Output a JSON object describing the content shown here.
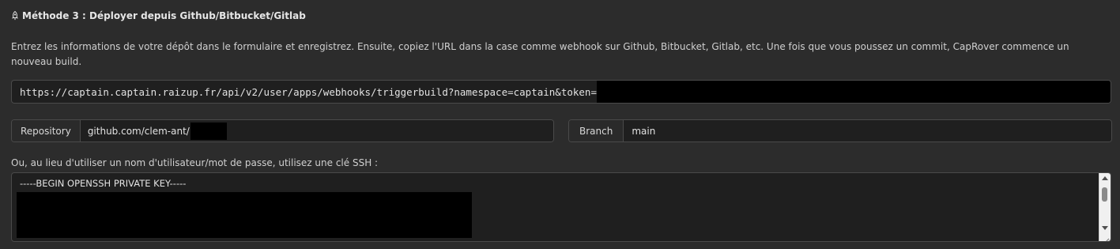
{
  "section": {
    "icon": "rocket-icon",
    "title": "Méthode 3 : Déployer depuis Github/Bitbucket/Gitlab"
  },
  "description": "Entrez les informations de votre dépôt dans le formulaire et enregistrez. Ensuite, copiez l'URL dans la case comme webhook sur Github, Bitbucket, Gitlab, etc. Une fois que vous poussez un commit, CapRover commence un nouveau build.",
  "webhook": {
    "url": "https://captain.captain.raizup.fr/api/v2/user/apps/webhooks/triggerbuild?namespace=captain&token="
  },
  "repository": {
    "label": "Repository",
    "value": "github.com/clem-ant/"
  },
  "branch": {
    "label": "Branch",
    "value": "main"
  },
  "ssh": {
    "label": "Ou, au lieu d'utiliser un nom d'utilisateur/mot de passe, utilisez une clé SSH :",
    "first_line": "-----BEGIN OPENSSH PRIVATE KEY-----"
  },
  "colors": {
    "background": "#2c2c2c",
    "input_background": "#1f1f1f",
    "border": "#4a4a4a",
    "redaction": "#000000"
  }
}
